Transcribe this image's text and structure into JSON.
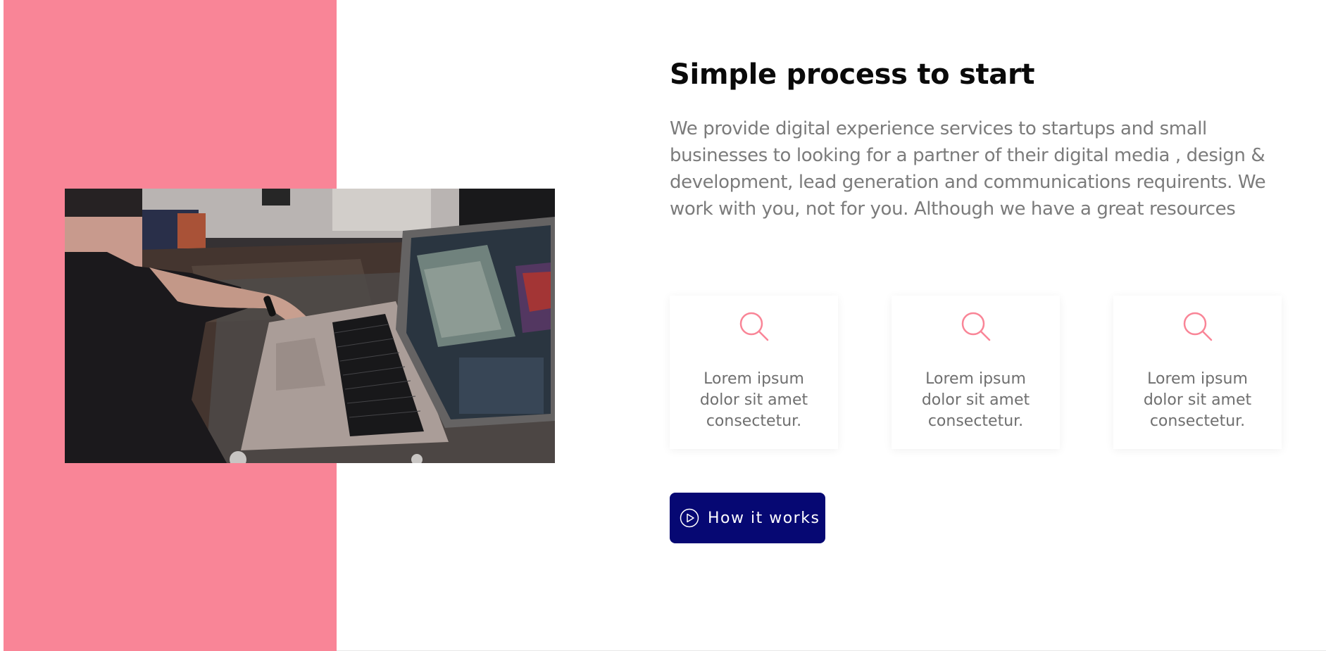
{
  "section": {
    "title": "Simple process to start",
    "description": "We provide digital experience services to startups and small businesses to looking for a partner of their digital media , design & development, lead generation and communications requirents. We work with you, not for you. Although we have a great resources",
    "accent_color": "#f98597",
    "button_color": "#060873"
  },
  "cards": [
    {
      "icon": "search-icon",
      "text": "Lorem ipsum dolor sit amet consectetur."
    },
    {
      "icon": "search-icon",
      "text": "Lorem ipsum dolor sit amet consectetur."
    },
    {
      "icon": "search-icon",
      "text": "Lorem ipsum dolor sit amet consectetur."
    }
  ],
  "cta": {
    "icon": "play-circle-icon",
    "label": "How it works"
  }
}
